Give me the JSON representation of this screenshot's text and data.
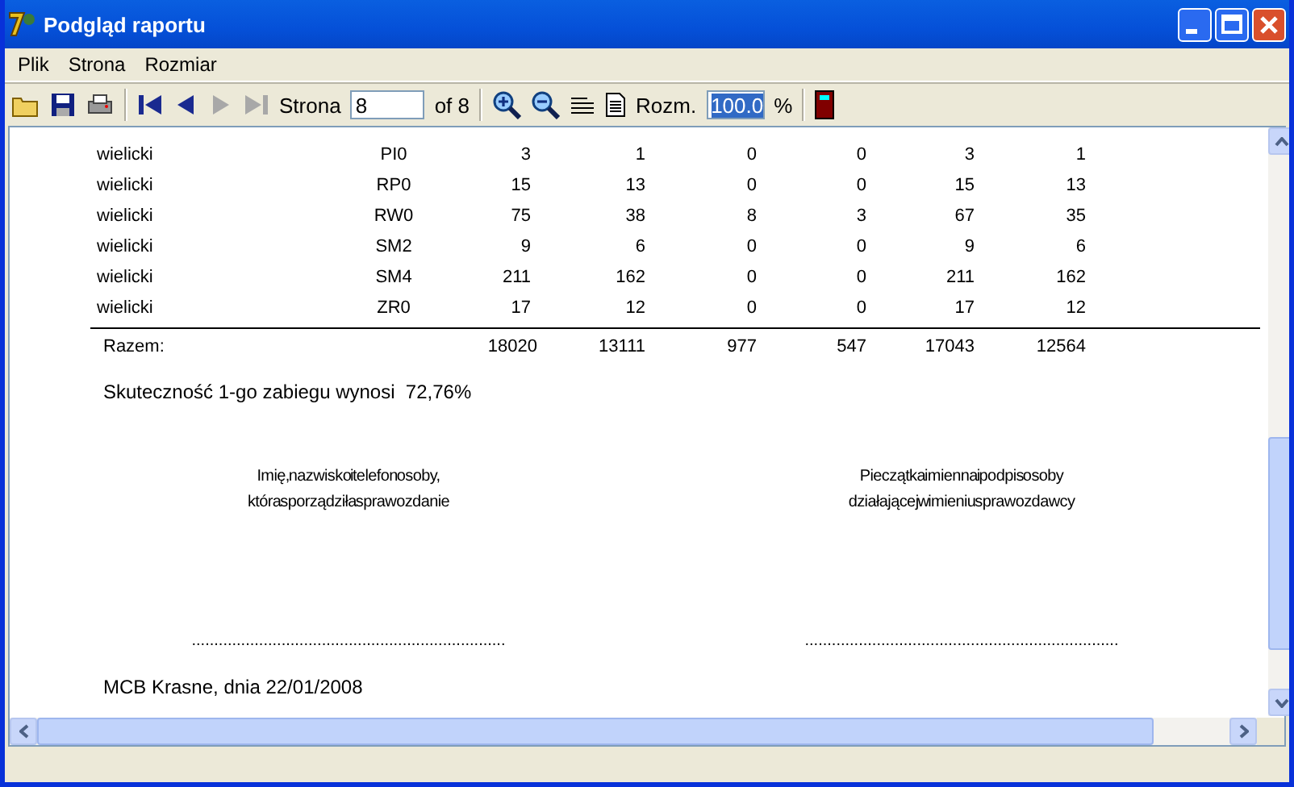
{
  "window": {
    "title": "Podgląd raportu"
  },
  "menu": [
    "Plik",
    "Strona",
    "Rozmiar"
  ],
  "toolbar": {
    "nav": [
      {
        "disabled": false
      },
      {
        "disabled": false
      },
      {
        "disabled": true
      },
      {
        "disabled": true
      }
    ],
    "page_label": "Strona",
    "page_value": "8",
    "page_total": "of 8",
    "zoom_label": "Rozm.",
    "zoom_value": "100.0",
    "zoom_selected": true,
    "zoom_unit": "%"
  },
  "table": {
    "rows": [
      [
        "wielicki",
        "PI0",
        "3",
        "1",
        "0",
        "0",
        "3",
        "1"
      ],
      [
        "wielicki",
        "RP0",
        "15",
        "13",
        "0",
        "0",
        "15",
        "13"
      ],
      [
        "wielicki",
        "RW0",
        "75",
        "38",
        "8",
        "3",
        "67",
        "35"
      ],
      [
        "wielicki",
        "SM2",
        "9",
        "6",
        "0",
        "0",
        "9",
        "6"
      ],
      [
        "wielicki",
        "SM4",
        "211",
        "162",
        "0",
        "0",
        "211",
        "162"
      ],
      [
        "wielicki",
        "ZR0",
        "17",
        "12",
        "0",
        "0",
        "17",
        "12"
      ]
    ],
    "total": [
      "Razem:",
      "18020",
      "13111",
      "977",
      "547",
      "17043",
      "12564"
    ]
  },
  "summary": "Skuteczność 1-go zabiegu wynosi  72,76%",
  "signatures": [
    {
      "line1": "Imię, nazwisko i telefon osoby,",
      "line2": "która sporządziła sprawozdanie",
      "dots": "......................................................................"
    },
    {
      "line1": "Pieczątka imienna i podpis osoby",
      "line2": "działającej w imieniu sprawozdawcy",
      "dots": "......................................................................"
    }
  ],
  "footer": "MCB Krasne, dnia 22/01/2008"
}
